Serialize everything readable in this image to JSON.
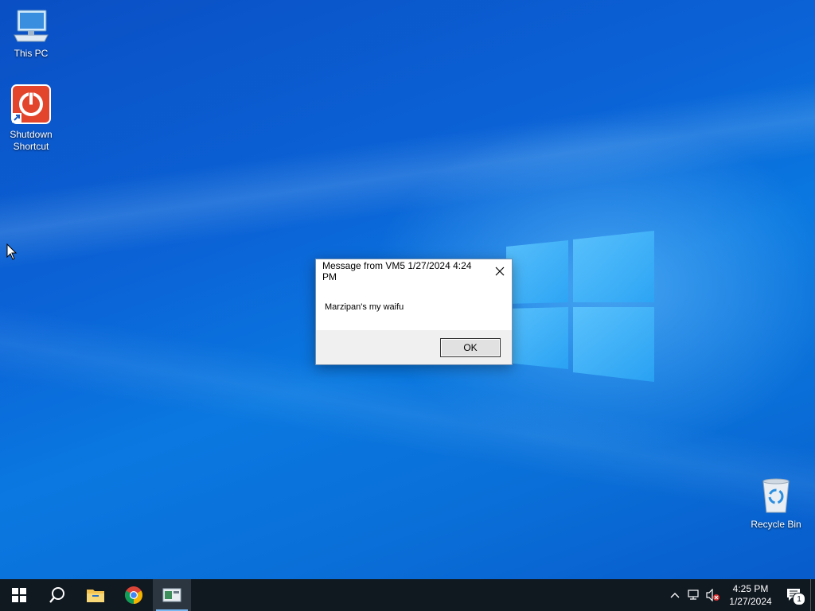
{
  "desktop": {
    "icons": [
      {
        "label": "This PC",
        "icon": "computer-icon"
      },
      {
        "label": "Shutdown Shortcut",
        "icon": "power-icon"
      },
      {
        "label": "Recycle Bin",
        "icon": "recycle-bin-icon"
      }
    ]
  },
  "dialog": {
    "title": "Message from VM5 1/27/2024 4:24 PM",
    "message": "Marzipan's my waifu",
    "ok_label": "OK"
  },
  "taskbar": {
    "items": [
      {
        "name": "start",
        "icon": "windows-icon"
      },
      {
        "name": "search",
        "icon": "search-icon"
      },
      {
        "name": "file-explorer",
        "icon": "folder-icon"
      },
      {
        "name": "chrome",
        "icon": "chrome-icon"
      },
      {
        "name": "app",
        "icon": "app-window-icon",
        "active": true
      }
    ],
    "clock": {
      "time": "4:25 PM",
      "date": "1/27/2024"
    },
    "notification_count": "1"
  },
  "colors": {
    "taskbar": "#101820",
    "desktop_blue": "#0a6fd8",
    "active_underline": "#7ab7f0"
  }
}
